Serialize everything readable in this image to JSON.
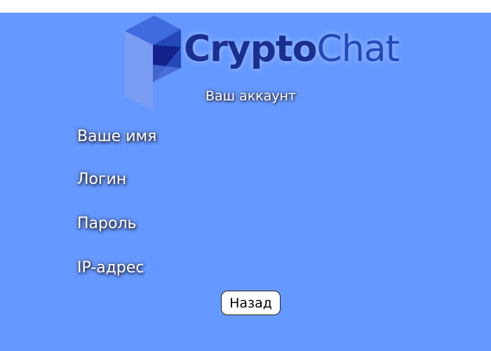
{
  "app": {
    "logo_part1": "Crypto",
    "logo_part2": "Chat",
    "logo_icon": "cube-logo-icon"
  },
  "page": {
    "heading": "Ваш аккаунт",
    "fields": {
      "name_label": "Ваше имя",
      "login_label": "Логин",
      "password_label": "Пароль",
      "ip_label": "IP-адрес"
    },
    "back_button": "Назад"
  },
  "colors": {
    "background": "#6699ff",
    "logo_dark": "#1a2f8f",
    "logo_light": "#2448b8",
    "button_bg": "#ffffff"
  }
}
